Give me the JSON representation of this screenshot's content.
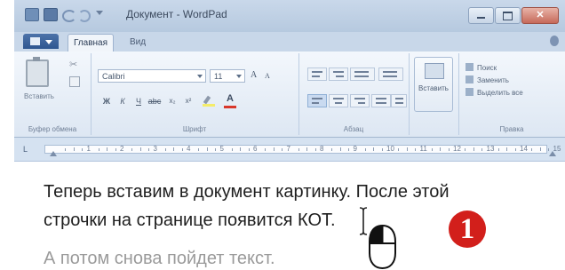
{
  "window": {
    "title": "Документ - WordPad",
    "app_icon": "wordpad-app-icon",
    "controls": [
      "minimize-icon",
      "maximize-icon",
      "close-icon"
    ]
  },
  "quick_access": [
    "save-icon",
    "undo-icon",
    "redo-icon",
    "customize-dropdown-icon"
  ],
  "tabs": [
    {
      "label": "Главная",
      "active": true
    },
    {
      "label": "Вид",
      "active": false
    }
  ],
  "ribbon": {
    "clipboard": {
      "paste_label": "Вставить",
      "group_label": "Буфер обмена"
    },
    "font": {
      "name": "Calibri",
      "size": "11",
      "grow": "A",
      "shrink": "A",
      "font_color_glyph": "A",
      "group_label": "Шрифт"
    },
    "paragraph": {
      "group_label": "Абзац"
    },
    "insert": {
      "picture_label": "Вставить"
    },
    "editing": {
      "find": "Поиск",
      "replace": "Заменить",
      "select_all": "Выделить все",
      "group_label": "Правка"
    }
  },
  "ruler": {
    "numbers": [
      "1",
      "2",
      "3",
      "4",
      "5",
      "6",
      "7",
      "8",
      "9",
      "10",
      "11",
      "12",
      "13",
      "14",
      "15"
    ],
    "tab_selector": "L"
  },
  "document": {
    "line1": "Теперь вставим в документ картинку. После этой",
    "line2": "строчки на странице появится КОТ.",
    "line3": "А потом снова пойдет текст."
  },
  "overlay": {
    "step_number": "1",
    "mouse_icon": "mouse-left-click-icon",
    "cursor_icon": "text-ibeam-cursor-icon"
  },
  "colors": {
    "titlebar": "#c9d8ea",
    "ribbon": "#e8eff8",
    "badge": "#d21f1b",
    "body_text": "#1e1e1e",
    "faded_text": "#9a9a9a"
  }
}
